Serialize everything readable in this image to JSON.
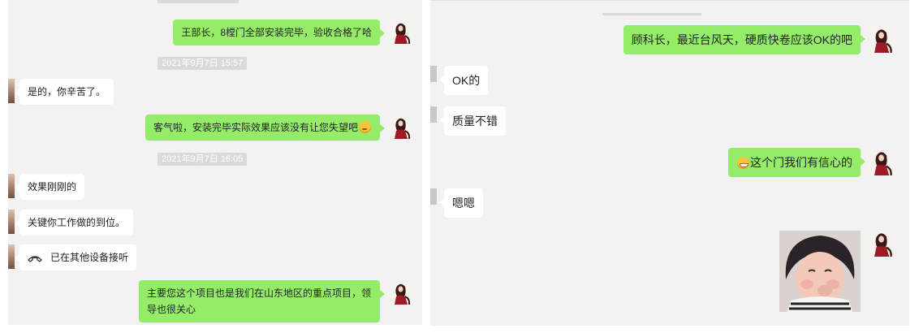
{
  "left": {
    "messages": {
      "m1": "王部长，8樘门全部安装完毕，验收合格了哈",
      "m2": "是的，你辛苦了。",
      "m3": "客气啦，安装完毕实际效果应该没有让您失望吧",
      "m4": "效果刚刚的",
      "m5": "关键你工作做的到位。",
      "m6": "已在其他设备接听",
      "m7_line1": "主要您这个项目也是我们在山东地区的重点项目，领",
      "m7_line2": "导也很关心"
    },
    "timestamps": {
      "t1": "2021年9月7日 15:57",
      "t2": "2021年9月7日 16:05"
    }
  },
  "right": {
    "messages": {
      "r1": "顾科长，最近台风天，硬质快卷应该OK的吧",
      "r2": "OK的",
      "r3": "质量不错",
      "r4": "这个门我们有信心的",
      "r5": "嗯嗯"
    }
  },
  "icons": {
    "call": "phone-handset-icon",
    "emoji_thinking": "thinking-face-emoji",
    "emoji_grin": "grinning-face-emoji"
  },
  "colors": {
    "panel_bg": "#f2f2f2",
    "sent_bubble": "#95ec69",
    "received_bubble": "#ffffff",
    "timestamp_bg": "#dadada"
  }
}
